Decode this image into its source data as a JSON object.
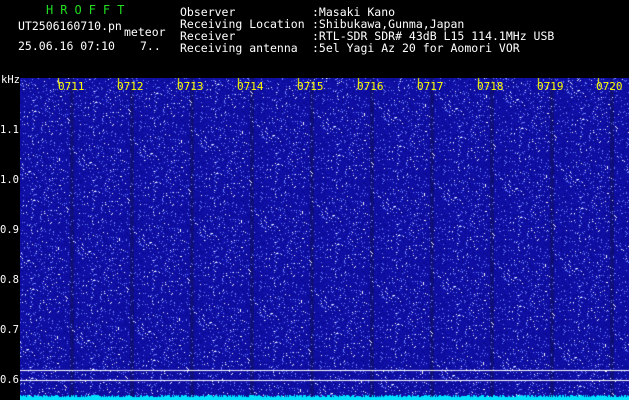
{
  "header": {
    "title": "HROFFT",
    "filename": "UT2506160710.pn",
    "mode": "meteor",
    "datetime": "25.06.16 07:10",
    "count": "7..",
    "fields": [
      {
        "label": "Observer",
        "value": ":Masaki Kano"
      },
      {
        "label": "Receiving Location",
        "value": ":Shibukawa,Gunma,Japan"
      },
      {
        "label": "Receiver",
        "value": ":RTL-SDR SDR# 43dB L15 114.1MHz USB"
      },
      {
        "label": "Receiving antenna",
        "value": ":5el Yagi Az 20 for Aomori VOR"
      }
    ]
  },
  "spectrogram": {
    "unit_label": "kHz",
    "y_ticks": [
      "1.1",
      "1.0",
      "0.9",
      "0.8",
      "0.7",
      "0.6"
    ],
    "x_ticks": [
      "0711",
      "0712",
      "0713",
      "0714",
      "0715",
      "0716",
      "0717",
      "0718",
      "0719",
      "0720"
    ],
    "colors": {
      "background": "#1a1a9a",
      "noise": "#ffffff",
      "baseline": "#00e0ff",
      "tick": "#ffff00",
      "title": "#22dd22"
    }
  }
}
